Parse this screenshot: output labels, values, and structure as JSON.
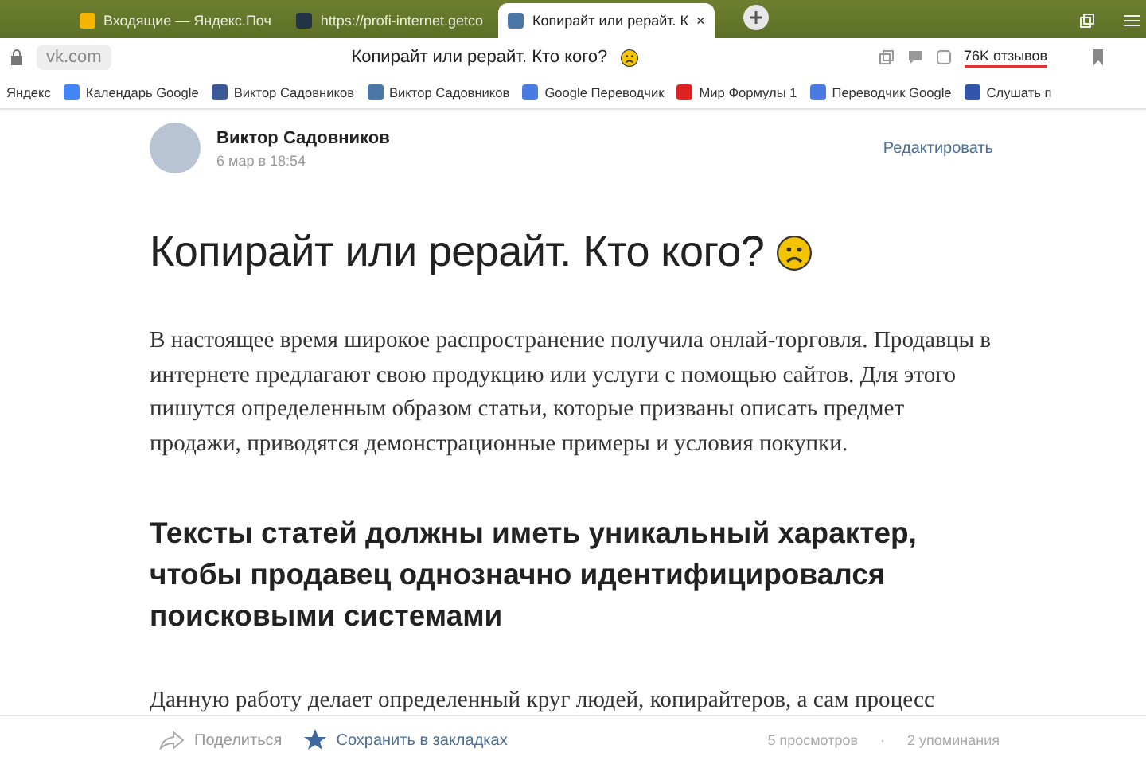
{
  "tabs": [
    {
      "title": "Входящие — Яндекс.Поч",
      "kind": "mail",
      "selected": false
    },
    {
      "title": "https://profi-internet.getco",
      "kind": "site",
      "selected": false
    },
    {
      "title": "Копирайт или рерайт. К",
      "kind": "vk",
      "selected": true,
      "close": "×"
    }
  ],
  "address": {
    "domain": "vk.com",
    "page_title": "Копирайт или рерайт. Кто кого?",
    "reviews": "76K отзывов"
  },
  "bookmarks": [
    {
      "label": "Яндекс",
      "kind": "none"
    },
    {
      "label": "Календарь Google",
      "kind": "calendar"
    },
    {
      "label": "Виктор Садовников",
      "kind": "fb"
    },
    {
      "label": "Виктор Садовников",
      "kind": "vk"
    },
    {
      "label": "Google Переводчик",
      "kind": "translate"
    },
    {
      "label": "Мир Формулы 1",
      "kind": "f1"
    },
    {
      "label": "Переводчик Google",
      "kind": "translate"
    },
    {
      "label": "Слушать п",
      "kind": "radio"
    }
  ],
  "author": {
    "name": "Виктор Садовников",
    "date": "6 мар в 18:54",
    "edit": "Редактировать"
  },
  "article": {
    "title": "Копирайт или рерайт. Кто кого?",
    "blocks": [
      {
        "kind": "paragraph",
        "text": "В настоящее время широкое распространение получила онлай-торговля. Продавцы в интернете предлагают свою продукцию или услуги с помощью сайтов. Для этого пишутся определенным образом статьи, которые призваны описать предмет продажи, приводятся демонстрационные примеры и условия покупки."
      },
      {
        "kind": "heading",
        "text": "Тексты статей должны иметь уникальный характер, чтобы продавец однозначно идентифицировался поисковыми системами"
      },
      {
        "kind": "paragraph",
        "text": "Данную работу делает определенный круг людей, копирайтеров, а сам процесс"
      }
    ]
  },
  "footer": {
    "share": "Поделиться",
    "bookmark": "Сохранить в закладках",
    "views": "5 просмотров",
    "separator": "·",
    "mentions": "2 упоминания"
  }
}
